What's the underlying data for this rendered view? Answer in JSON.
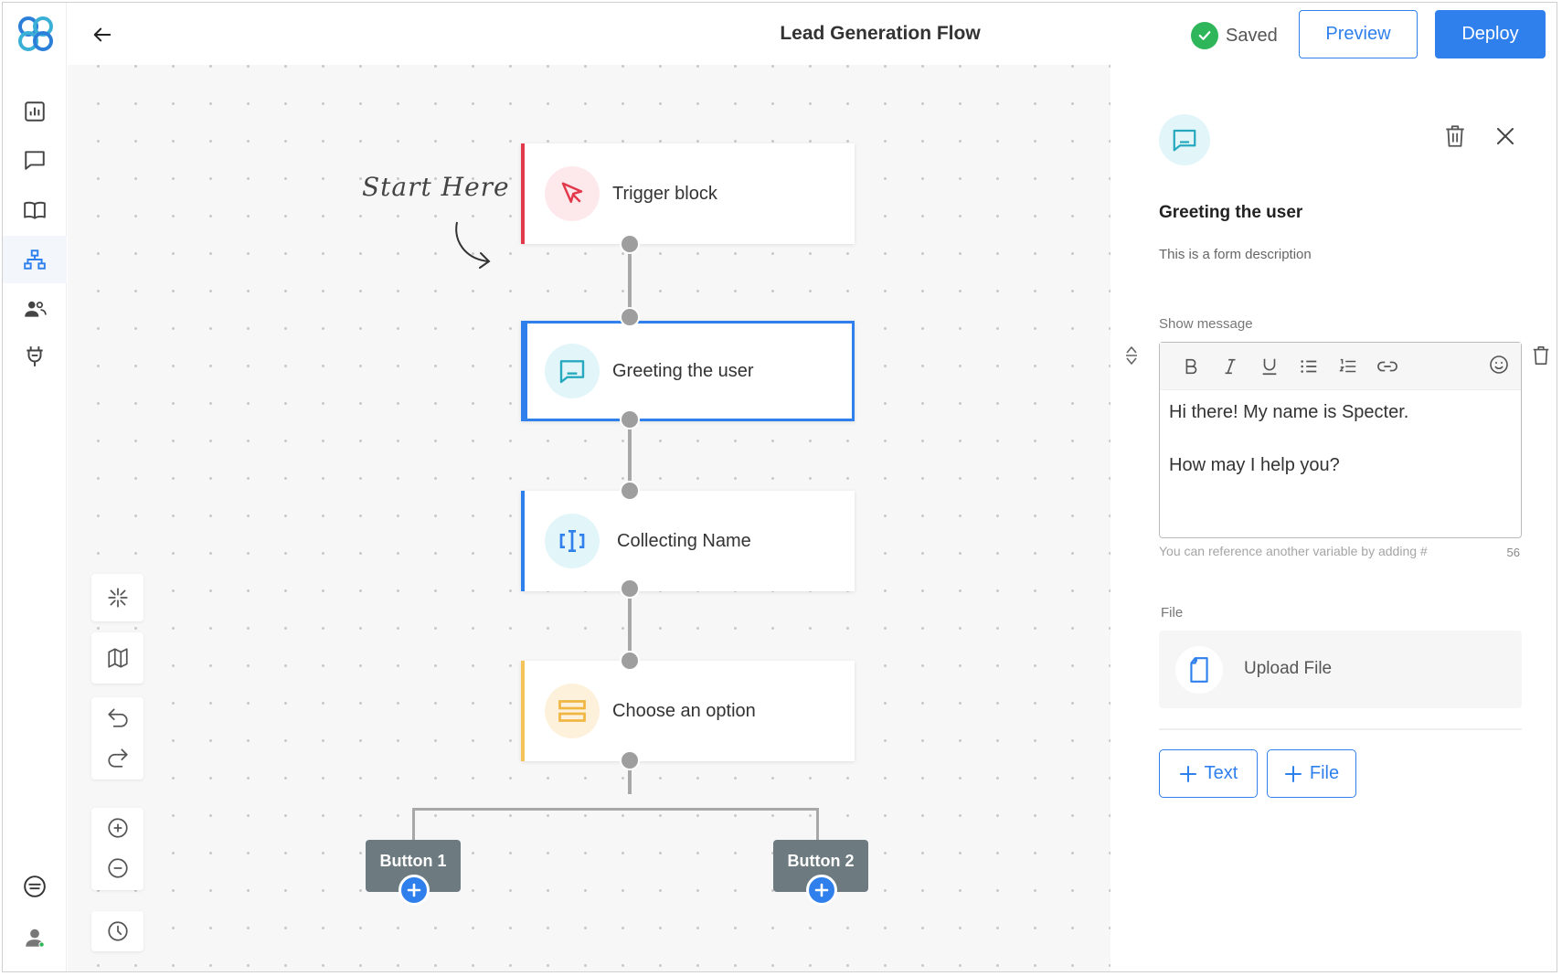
{
  "header": {
    "title": "Lead Generation Flow",
    "saved_status": "Saved",
    "preview_label": "Preview",
    "deploy_label": "Deploy"
  },
  "sidebar": {
    "items": [
      {
        "icon": "analytics-icon"
      },
      {
        "icon": "chat-icon"
      },
      {
        "icon": "book-icon"
      },
      {
        "icon": "flow-icon",
        "active": true
      },
      {
        "icon": "users-icon"
      },
      {
        "icon": "plug-icon"
      }
    ],
    "bottom": [
      {
        "icon": "bot-icon"
      },
      {
        "icon": "avatar-icon"
      }
    ]
  },
  "canvas": {
    "annotation": "Start Here",
    "blocks": [
      {
        "label": "Trigger block",
        "icon": "cursor-icon",
        "accent": "#e2394b"
      },
      {
        "label": "Greeting the user",
        "icon": "message-icon",
        "accent": "#2f80ed",
        "selected": true
      },
      {
        "label": "Collecting Name",
        "icon": "text-input-icon",
        "accent": "#2f80ed"
      },
      {
        "label": "Choose an option",
        "icon": "list-icon",
        "accent": "#f4c35a"
      }
    ],
    "branches": [
      {
        "label": "Button 1"
      },
      {
        "label": "Button 2"
      }
    ]
  },
  "panel": {
    "title": "Greeting the user",
    "description": "This is a form description",
    "message_label": "Show message",
    "message_line1": "Hi there! My name is Specter.",
    "message_line2": "How may I help you?",
    "hint": "You can reference another variable by adding #",
    "char_count": "56",
    "file_label": "File",
    "upload_label": "Upload File",
    "add_text_label": "Text",
    "add_file_label": "File"
  },
  "colors": {
    "primary": "#2f80ed",
    "success": "#2fb65a",
    "trigger": "#e2394b",
    "option": "#f4c35a",
    "node_connector": "#9e9e9e",
    "branch_button": "#6d7a80"
  }
}
